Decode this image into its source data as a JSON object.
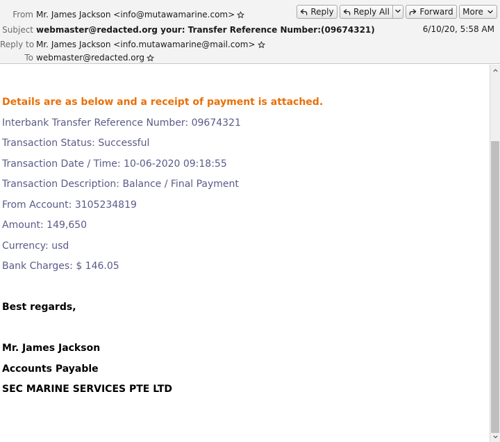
{
  "header": {
    "from_label": "From",
    "from_value": "Mr. James Jackson <info@mutawamarine.com>",
    "subject_label": "Subject",
    "subject_value": "webmaster@redacted.org your: Transfer Reference Number:(09674321)",
    "replyto_label": "Reply to",
    "replyto_value": "Mr. James Jackson <info.mutawamarine@mail.com>",
    "to_label": "To",
    "to_value": "webmaster@redacted.org",
    "date": "6/10/20, 5:58 AM"
  },
  "toolbar": {
    "reply_label": "Reply",
    "reply_all_label": "Reply All",
    "forward_label": "Forward",
    "more_label": "More"
  },
  "message": {
    "intro": "Details are as below and a receipt of payment is attached.",
    "reference": "Interbank Transfer Reference Number: 09674321",
    "status": "Transaction Status: Successful",
    "datetime": "Transaction Date / Time: 10-06-2020 09:18:55",
    "description": "Transaction Description: Balance / Final Payment",
    "from_account": "From Account: 3105234819",
    "amount": "Amount: 149,650",
    "currency": "Currency: usd",
    "charges": "Bank Charges: $ 146.05",
    "regards": "Best regards,",
    "sig_name": "Mr. James Jackson",
    "sig_title": "Accounts Payable",
    "sig_company": "SEC MARINE SERVICES PTE LTD"
  },
  "icons": {
    "star": "star-outline-icon",
    "reply": "reply-arrow-icon",
    "forward": "forward-arrow-icon",
    "dropdown": "chevron-down-icon"
  },
  "colors": {
    "body_text": "#5a5a88",
    "highlight": "#e8700a",
    "header_bg": "#f3f3f3"
  }
}
